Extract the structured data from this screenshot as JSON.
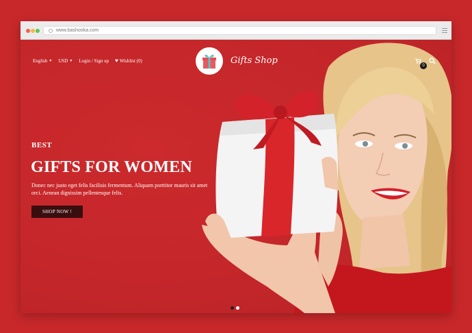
{
  "browser": {
    "url": "www.bashooka.com"
  },
  "nav": {
    "language": "English",
    "currency": "USD",
    "login": "Login / Sign up",
    "wishlist": "Wishlist (0)",
    "cart_count": "0"
  },
  "brand": {
    "name": "Gifts Shop"
  },
  "hero": {
    "subtitle": "BEST",
    "title": "GIFTS FOR WOMEN",
    "description": "Donec nec justo eget felis facilisis fermentum. Aliquam porttitor mauris sit amet orci. Aenean dignissim pellentesque felis.",
    "button_label": "SHOP NOW !"
  },
  "slider": {
    "slides": 2,
    "active": 1
  },
  "colors": {
    "background": "#c8282a",
    "button": "#3a0e0e",
    "gift_ribbon": "#d8262a"
  }
}
